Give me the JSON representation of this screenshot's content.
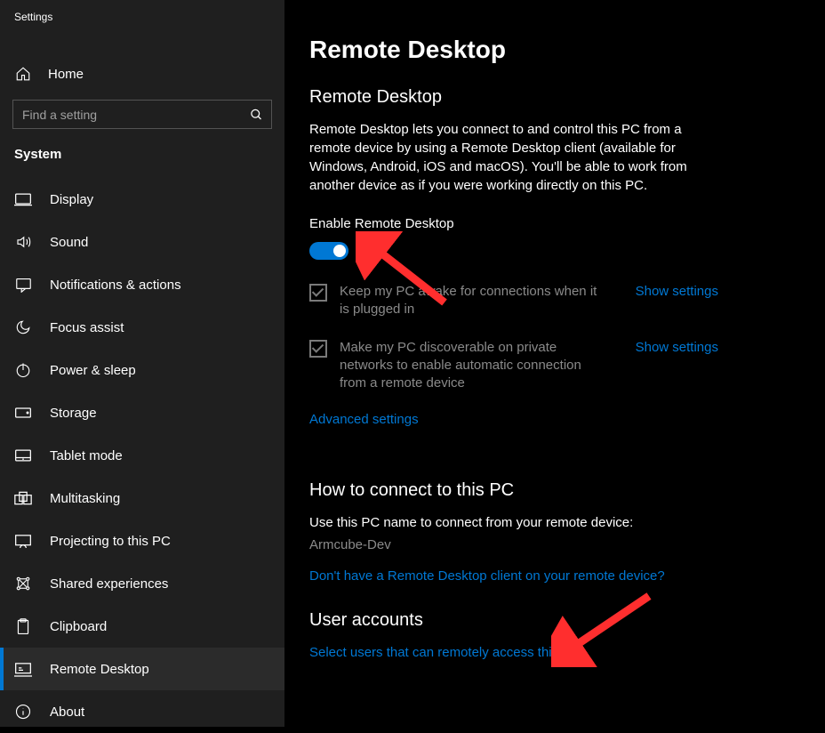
{
  "app_title": "Settings",
  "home_label": "Home",
  "search_placeholder": "Find a setting",
  "section_label": "System",
  "nav_items": [
    {
      "id": "display",
      "label": "Display"
    },
    {
      "id": "sound",
      "label": "Sound"
    },
    {
      "id": "notifications",
      "label": "Notifications & actions"
    },
    {
      "id": "focus",
      "label": "Focus assist"
    },
    {
      "id": "power",
      "label": "Power & sleep"
    },
    {
      "id": "storage",
      "label": "Storage"
    },
    {
      "id": "tablet",
      "label": "Tablet mode"
    },
    {
      "id": "multitasking",
      "label": "Multitasking"
    },
    {
      "id": "projecting",
      "label": "Projecting to this PC"
    },
    {
      "id": "shared",
      "label": "Shared experiences"
    },
    {
      "id": "clipboard",
      "label": "Clipboard"
    },
    {
      "id": "remote",
      "label": "Remote Desktop",
      "selected": true
    },
    {
      "id": "about",
      "label": "About"
    }
  ],
  "page": {
    "title": "Remote Desktop",
    "subtitle": "Remote Desktop",
    "description": "Remote Desktop lets you connect to and control this PC from a remote device by using a Remote Desktop client (available for Windows, Android, iOS and macOS). You'll be able to work from another device as if you were working directly on this PC.",
    "enable_label": "Enable Remote Desktop",
    "toggle_state": "On",
    "check1": "Keep my PC awake for connections when it is plugged in",
    "check2": "Make my PC discoverable on private networks to enable automatic connection from a remote device",
    "show_settings": "Show settings",
    "advanced": "Advanced settings",
    "how_to_header": "How to connect to this PC",
    "how_to_text": "Use this PC name to connect from your remote device:",
    "pc_name": "Armcube-Dev",
    "client_link": "Don't have a Remote Desktop client on your remote device?",
    "user_accounts_header": "User accounts",
    "select_users_link": "Select users that can remotely access this PC"
  }
}
